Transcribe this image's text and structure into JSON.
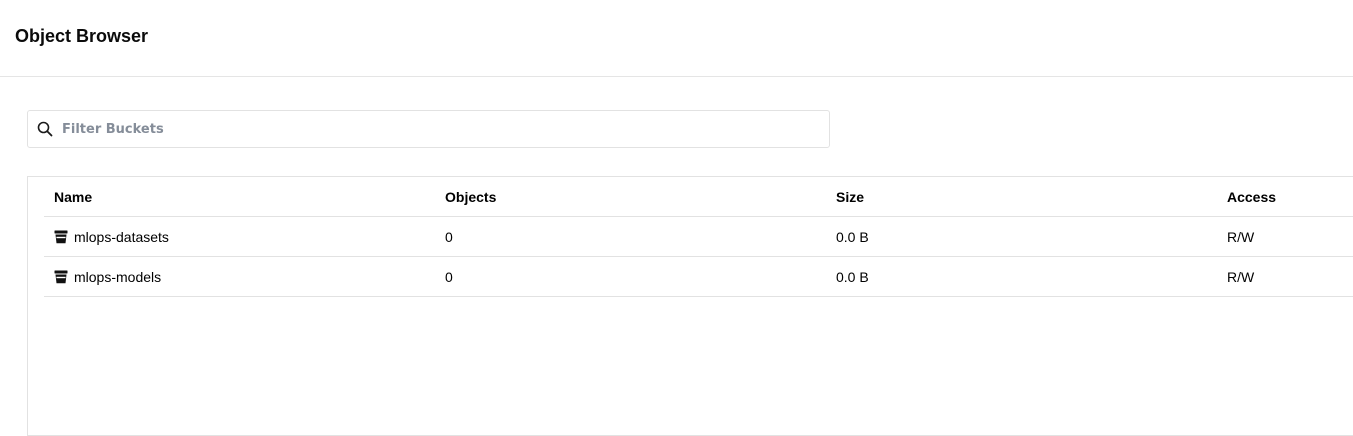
{
  "header": {
    "title": "Object Browser"
  },
  "search": {
    "placeholder": "Filter Buckets",
    "value": "",
    "icon": "search-icon"
  },
  "table": {
    "columns": {
      "name": "Name",
      "objects": "Objects",
      "size": "Size",
      "access": "Access"
    },
    "rows": [
      {
        "name": "mlops-datasets",
        "objects": "0",
        "size": "0.0 B",
        "access": "R/W",
        "icon": "bucket-icon"
      },
      {
        "name": "mlops-models",
        "objects": "0",
        "size": "0.0 B",
        "access": "R/W",
        "icon": "bucket-icon"
      }
    ]
  }
}
